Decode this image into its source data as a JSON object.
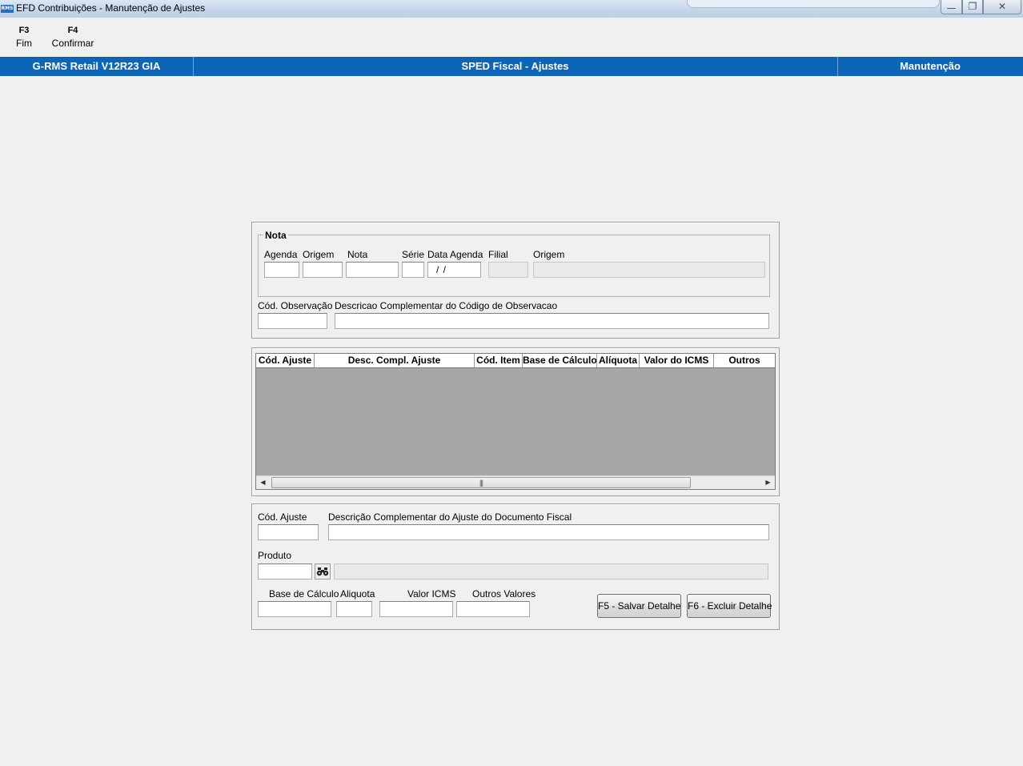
{
  "window": {
    "title": "EFD Contribuições - Manutenção de Ajustes",
    "icon": "RMS",
    "controls": {
      "minimize": "▭",
      "maximize": "❐",
      "close": "✕"
    }
  },
  "function_keys": [
    {
      "key": "F3",
      "label": "Fim"
    },
    {
      "key": "F4",
      "label": "Confirmar"
    }
  ],
  "header": {
    "left": "G-RMS Retail V12R23 GIA",
    "center": "SPED Fiscal - Ajustes",
    "right": "Manutenção",
    "color": "#0b65b8"
  },
  "nota": {
    "title": "Nota",
    "fields": {
      "agenda": {
        "label": "Agenda",
        "value": ""
      },
      "origem": {
        "label": "Origem",
        "value": ""
      },
      "nota": {
        "label": "Nota",
        "value": ""
      },
      "serie": {
        "label": "Série",
        "value": ""
      },
      "data_agenda": {
        "label": "Data Agenda",
        "value": " /  /"
      },
      "filial": {
        "label": "Filial",
        "value": ""
      },
      "origem_desc": {
        "label": "Origem",
        "value": ""
      }
    }
  },
  "observacao": {
    "cod_label": "Cód. Observação",
    "cod_value": "",
    "desc_label": "Descricao Complementar do Código de Observacao",
    "desc_value": ""
  },
  "grid": {
    "columns": [
      "Cód. Ajuste",
      "Desc. Compl. Ajuste",
      "Cód. Item",
      "Base de Cálculo",
      "Alíquota",
      "Valor do ICMS",
      "Outros"
    ],
    "rows": [],
    "scroll_grip": "|||",
    "scroll_left": "◀",
    "scroll_right": "▶"
  },
  "detalhe": {
    "cod_ajuste_label": "Cód. Ajuste",
    "cod_ajuste_value": "",
    "desc_label": "Descrição Complementar do Ajuste do Documento Fiscal",
    "desc_value": "",
    "produto_label": "Produto",
    "produto_value": "",
    "produto_desc": "",
    "base_label": "Base de Cálculo",
    "base_value": "",
    "aliquota_label": "Aliquota",
    "aliquota_value": "",
    "valor_icms_label": "Valor ICMS",
    "valor_icms_value": "",
    "outros_label": "Outros Valores",
    "outros_value": "",
    "save_button": "F5 - Salvar Detalhe",
    "delete_button": "F6 - Excluir Detalhe"
  }
}
